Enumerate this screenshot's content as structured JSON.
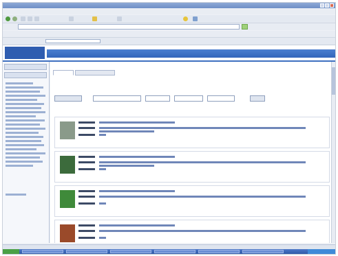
{
  "colors": {
    "accent": "#3d6fc0",
    "title_bar": "#7b9bd0",
    "link": "#3a5590",
    "taskbar": "#2f5aa8",
    "start_button": "#4aa046"
  },
  "icons": {
    "back": "back-arrow-icon",
    "go": "go-arrow-icon",
    "home": "home-icon",
    "search": "search-icon",
    "close": "close-icon"
  },
  "records": [
    {
      "thumb_color": "#8a9a8a",
      "lines": 2
    },
    {
      "thumb_color": "#3c6b3c",
      "lines": 2
    },
    {
      "thumb_color": "#3f8a3a",
      "lines": 1
    },
    {
      "thumb_color": "#9a4a2a",
      "lines": 1
    }
  ]
}
